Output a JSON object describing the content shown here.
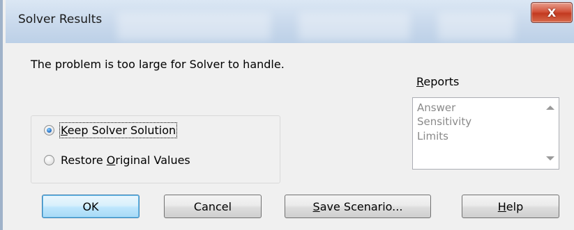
{
  "window": {
    "title": "Solver Results",
    "close_glyph": "X"
  },
  "message": "The problem is too large for Solver to handle.",
  "options": [
    {
      "before": "",
      "key": "K",
      "after": "eep Solver Solution",
      "selected": true
    },
    {
      "before": "Restore ",
      "key": "O",
      "after": "riginal Values",
      "selected": false
    }
  ],
  "reports": {
    "label_key": "R",
    "label_rest": "eports",
    "items": [
      "Answer",
      "Sensitivity",
      "Limits"
    ]
  },
  "buttons": {
    "ok": "OK",
    "cancel": "Cancel",
    "save_key": "S",
    "save_rest": "ave Scenario...",
    "help_key": "H",
    "help_rest": "elp"
  },
  "colors": {
    "title_bar": "#c9d9ec",
    "close_button": "#c23a20",
    "default_button_border": "#3c7fb1",
    "disabled_text": "#8a8a8a"
  }
}
